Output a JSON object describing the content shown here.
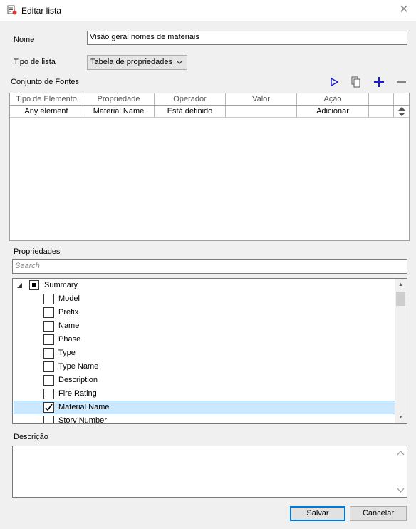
{
  "window": {
    "title": "Editar lista",
    "icon": "list-edit-icon"
  },
  "form": {
    "name_label": "Nome",
    "name_value": "Visão geral nomes de materiais",
    "list_type_label": "Tipo de lista",
    "list_type_value": "Tabela de propriedades",
    "source_set_label": "Conjunto de  Fontes"
  },
  "toolbar": {
    "run_icon": "play-icon",
    "copy_icon": "copy-icon",
    "add_icon": "plus-icon",
    "remove_icon": "minus-icon",
    "accent_color": "#1a1adb"
  },
  "grid": {
    "columns": [
      "Tipo de Elemento",
      "Propriedade",
      "Operador",
      "Valor",
      "Ação",
      ""
    ],
    "rows": [
      [
        "Any element",
        "Material Name",
        "Está definido",
        "",
        "Adicionar",
        ""
      ]
    ]
  },
  "properties": {
    "label": "Propriedades",
    "search_placeholder": "Search",
    "root": {
      "label": "Summary",
      "state": "partial"
    },
    "items": [
      {
        "label": "Model",
        "checked": false
      },
      {
        "label": "Prefix",
        "checked": false
      },
      {
        "label": "Name",
        "checked": false
      },
      {
        "label": "Phase",
        "checked": false
      },
      {
        "label": "Type",
        "checked": false
      },
      {
        "label": "Type Name",
        "checked": false
      },
      {
        "label": "Description",
        "checked": false
      },
      {
        "label": "Fire Rating",
        "checked": false
      },
      {
        "label": "Material Name",
        "checked": true,
        "selected": true
      },
      {
        "label": "Story Number",
        "checked": false
      }
    ]
  },
  "description": {
    "label": "Descrição",
    "value": ""
  },
  "buttons": {
    "save": "Salvar",
    "cancel": "Cancelar"
  }
}
